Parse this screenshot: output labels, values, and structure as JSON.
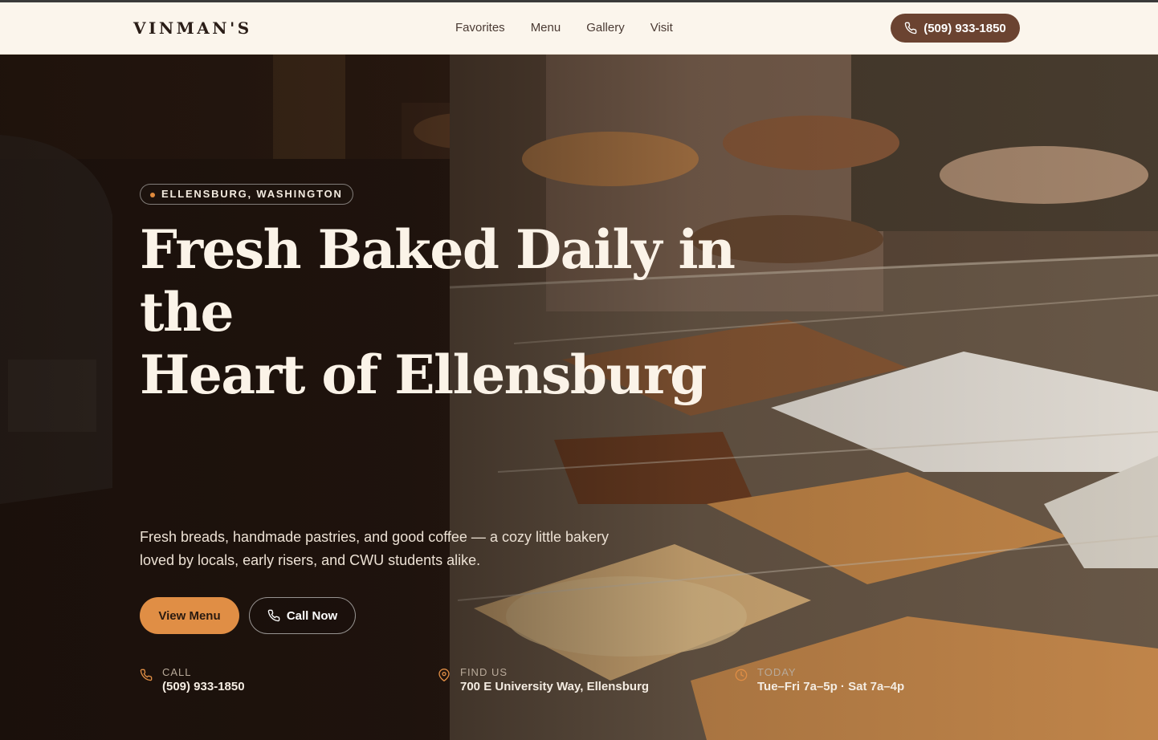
{
  "brand": {
    "name": "VINMAN'S"
  },
  "nav": {
    "items": [
      "Favorites",
      "Menu",
      "Gallery",
      "Visit"
    ]
  },
  "header": {
    "phone": "(509) 933-1850"
  },
  "hero": {
    "badge": "ELLENSBURG, WASHINGTON",
    "headline_line1": "Fresh Baked Daily in the",
    "headline_line2": "Heart of Ellensburg",
    "subtitle": "Fresh breads, handmade pastries, and good coffee — a cozy little bakery loved by locals, early risers, and CWU students alike.",
    "primary_button": "View Menu",
    "secondary_button": "Call Now"
  },
  "info": {
    "call": {
      "label": "CALL",
      "value": "(509) 933-1850"
    },
    "find": {
      "label": "FIND US",
      "value": "700 E University Way, Ellensburg"
    },
    "today": {
      "label": "TODAY",
      "value": "Tue–Fri 7a–5p · Sat 7a–4p"
    }
  },
  "colors": {
    "accent": "#e08e45",
    "brand_dark": "#6b4331",
    "header_bg": "#fbf5ec"
  },
  "icons": {
    "phone": "phone-icon",
    "pin": "map-pin-icon",
    "clock": "clock-icon"
  }
}
